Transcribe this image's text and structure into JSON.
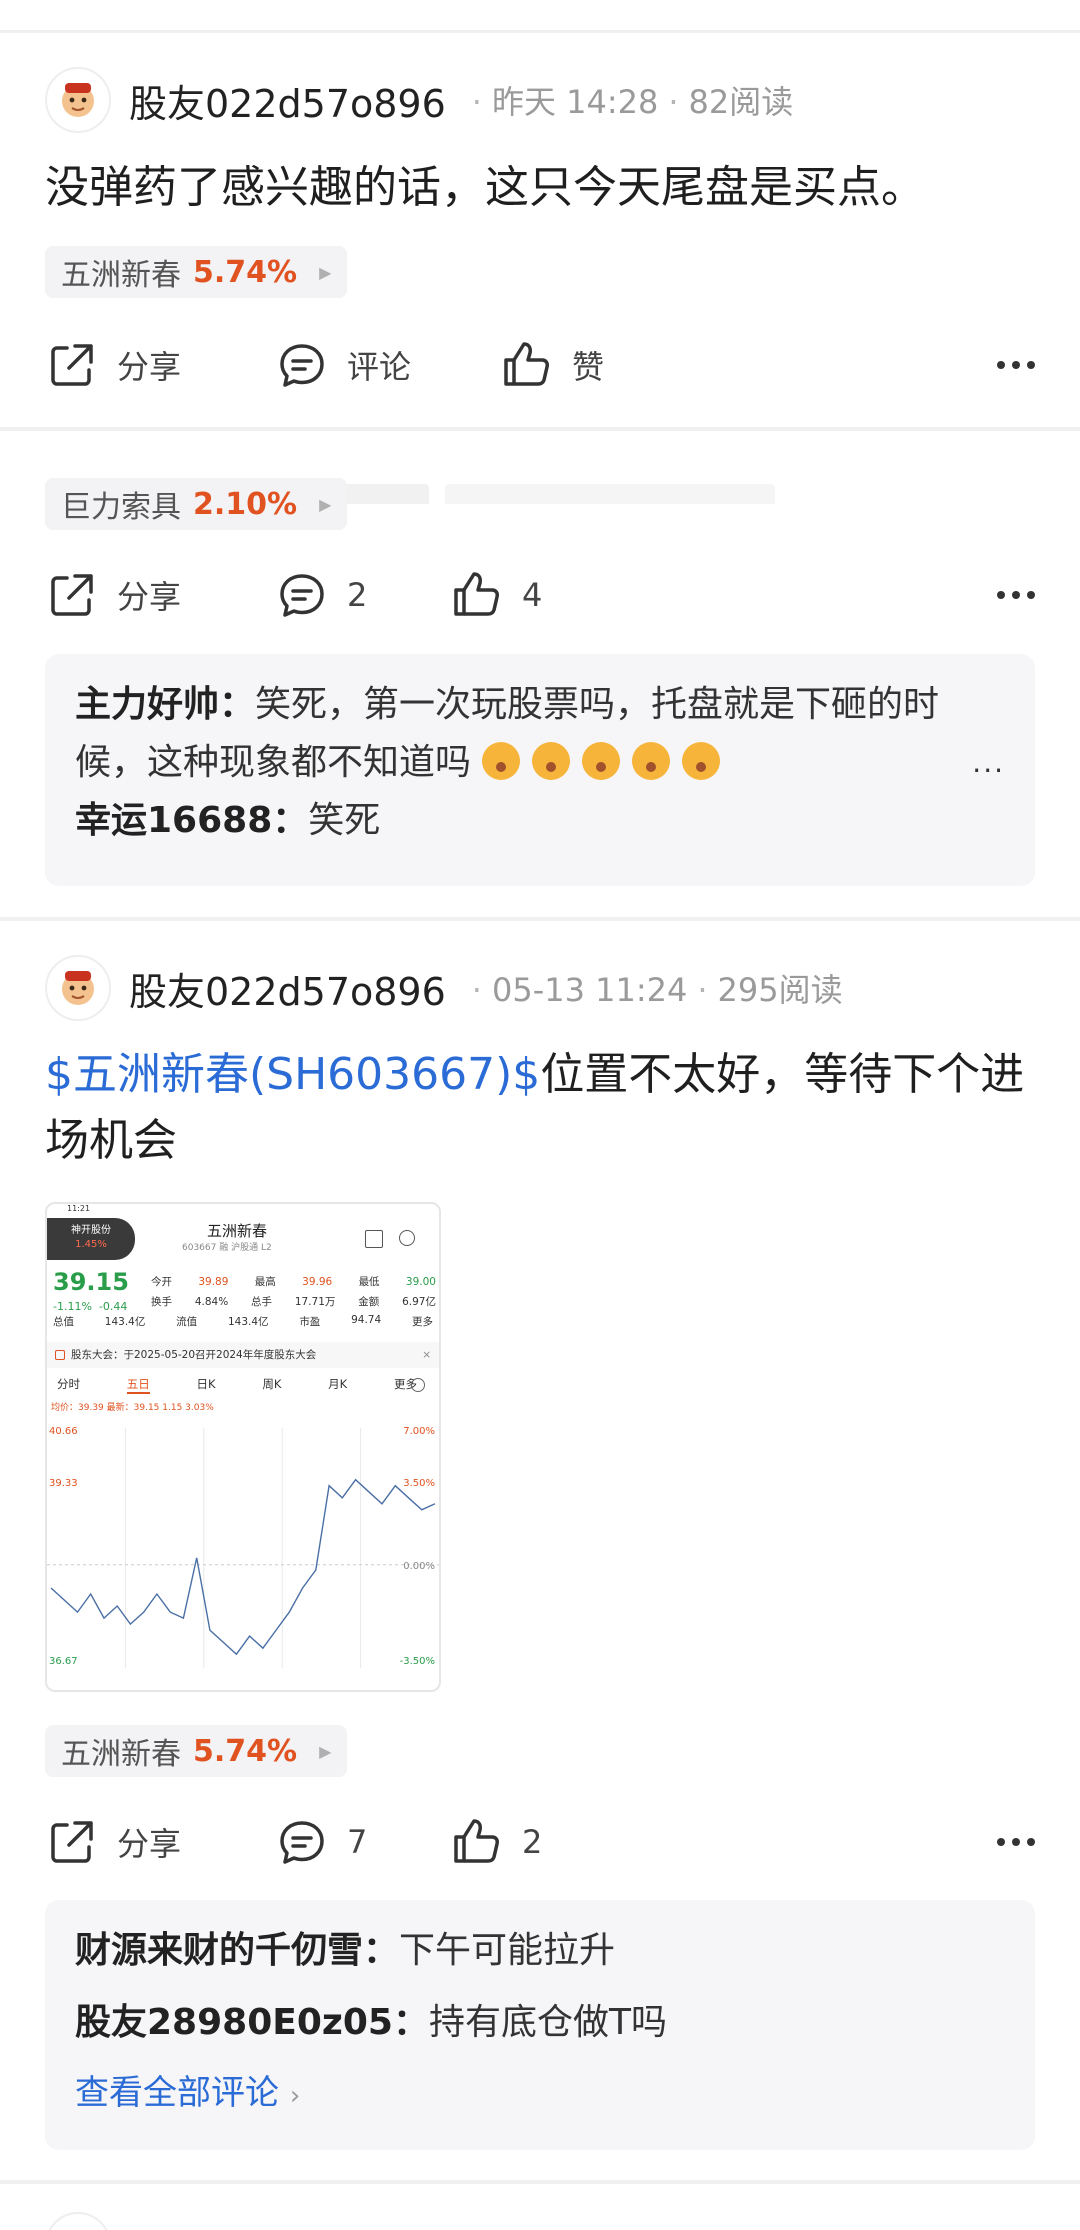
{
  "posts": [
    {
      "author": "股友022d57o896",
      "time": "昨天 14:28",
      "reads": "82阅读",
      "text": "没弹药了感兴趣的话，这只今天尾盘是买点。",
      "stock": {
        "name": "五洲新春",
        "pct": "5.74%"
      },
      "actions": {
        "share": "分享",
        "comment": "评论",
        "like": "赞"
      }
    },
    {
      "stock": {
        "name": "巨力索具",
        "pct": "2.10%"
      },
      "actions": {
        "share": "分享",
        "comment": "2",
        "like": "4"
      },
      "comments": [
        {
          "user": "主力好帅",
          "text": "笑死，第一次玩股票吗，托盘就是下砸的时候，这种现象都不知道吗"
        },
        {
          "user": "幸运16688",
          "text": "笑死"
        }
      ],
      "more": "..."
    },
    {
      "author": "股友022d57o896",
      "time": "05-13 11:24",
      "reads": "295阅读",
      "text_link": "$五洲新春(SH603667)$",
      "text": "位置不太好，等待下个进场机会",
      "stock": {
        "name": "五洲新春",
        "pct": "5.74%"
      },
      "actions": {
        "share": "分享",
        "comment": "7",
        "like": "2"
      },
      "comments": [
        {
          "user": "财源来财的千仞雪",
          "text": "下午可能拉升"
        },
        {
          "user": "股友28980E0z05",
          "text": "持有底仓做T吗"
        }
      ],
      "see_all": "查看全部评论"
    }
  ],
  "chart_thumb": {
    "status_time": "11:21",
    "badge_name": "神开股份",
    "badge_pct": "1.45%",
    "title": "五洲新春",
    "code": "603667",
    "code_tags": "融 沪股通 L2",
    "price": "39.15",
    "change_pct": "-1.11%",
    "change": "-0.44",
    "stats_row1": [
      "今开",
      "39.89",
      "最高",
      "39.96",
      "最低",
      "39.00"
    ],
    "stats_row2": [
      "换手",
      "4.84%",
      "总手",
      "17.71万",
      "金额",
      "6.97亿"
    ],
    "stats_row3": [
      "总值",
      "143.4亿",
      "流值",
      "143.4亿",
      "市盈",
      "94.74",
      "更多"
    ],
    "notice": "股东大会：于2025-05-20召开2024年年度股东大会",
    "tabs": [
      "分时",
      "五日",
      "日K",
      "周K",
      "月K",
      "更多"
    ],
    "avg_line": "均价：39.39 最新：39.15 1.15 3.03%",
    "y_left": [
      "40.66",
      "39.33",
      "",
      "36.67"
    ],
    "y_right": [
      "7.00%",
      "3.50%",
      "0.00%",
      "-3.50%"
    ],
    "colors": {
      "up": "#e0521f",
      "down": "#2a9d4a",
      "line": "#4a6fa5"
    }
  },
  "chart_data": {
    "type": "line",
    "title": "五洲新春",
    "ylim": [
      36.67,
      40.66
    ],
    "series": [
      {
        "values": [
          38.0,
          37.8,
          37.6,
          37.9,
          37.5,
          37.7,
          37.4,
          37.6,
          37.9,
          37.6,
          37.5,
          38.5,
          37.3,
          37.1,
          36.9,
          37.2,
          37.0,
          37.3,
          37.6,
          38.0,
          38.3,
          39.7,
          39.5,
          39.8,
          39.6,
          39.4,
          39.7,
          39.5,
          39.3,
          39.4
        ]
      }
    ]
  }
}
